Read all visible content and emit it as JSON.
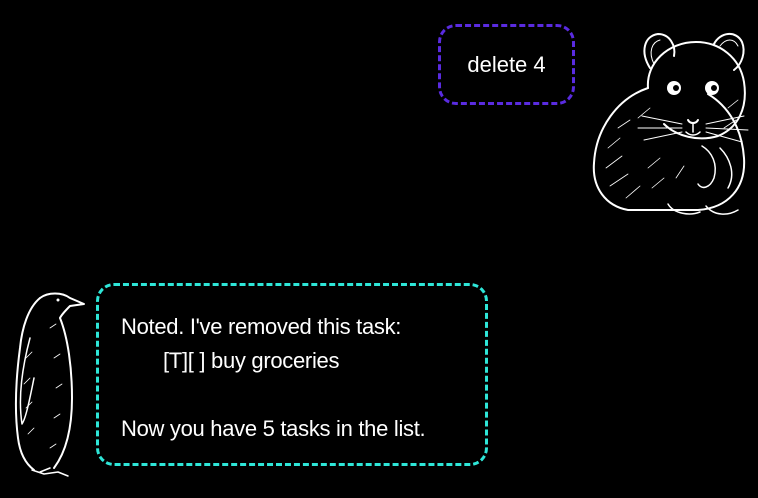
{
  "user_message": {
    "text": "delete 4",
    "border_color": "#5a2be0"
  },
  "bot_message": {
    "lines": [
      "Noted. I've removed this task:",
      "[T][ ] buy groceries",
      "",
      "Now you have 5 tasks in the list."
    ],
    "border_color": "#2ee6d8"
  },
  "avatars": {
    "user": "hamster-icon",
    "bot": "penguin-icon"
  },
  "background_color": "#000000"
}
